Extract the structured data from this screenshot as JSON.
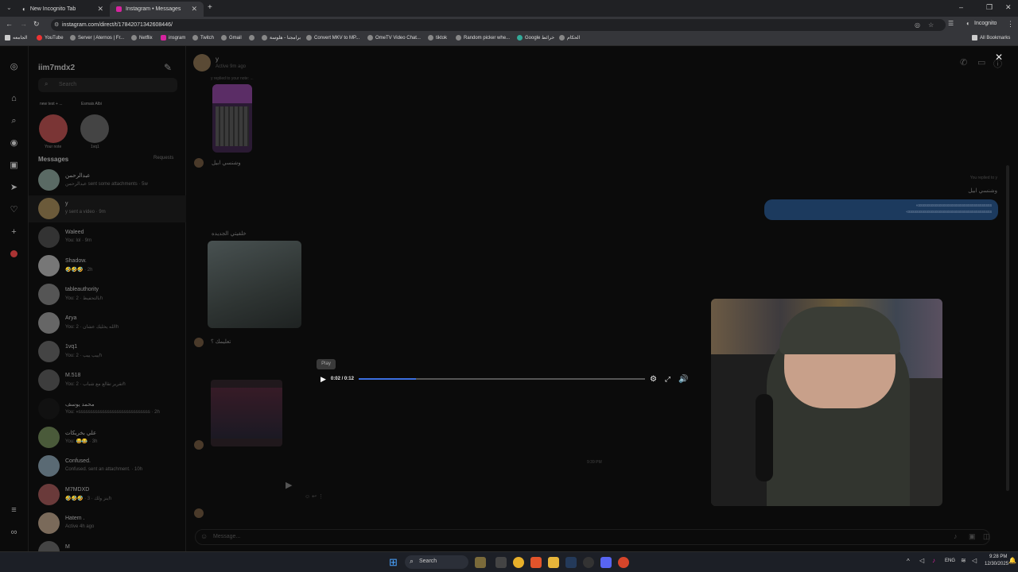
{
  "browser": {
    "tabs": [
      {
        "title": "New Incognito Tab",
        "close": "✕"
      },
      {
        "title": "Instagram • Messages",
        "close": "✕"
      }
    ],
    "new_tab": "+",
    "url": "instagram.com/direct/t/17842071342608446/",
    "incognito": "Incognito",
    "bookmarks": [
      "الجامعه",
      "YouTube",
      "Server | Aternos | Fr...",
      "Netflix",
      "insgram",
      "Twitch",
      "Gmail",
      "",
      "برامجنا - هلوسة",
      "Convert MKV to MP...",
      "OmeTV Video Chat...",
      "tiktok",
      "Random picker whe...",
      "Google خرائط",
      "الحكام"
    ],
    "all_bookmarks": "All Bookmarks"
  },
  "sidebar": {
    "username": "iim7mdx2",
    "search_placeholder": "Search",
    "notes": [
      {
        "note": "new test + ...",
        "label": "Your note"
      },
      {
        "note": "Esmais Albi",
        "label": "1vq1"
      }
    ],
    "messages_header": "Messages",
    "requests": "Requests",
    "conversations": [
      {
        "name": "عبدالرحمن",
        "sub": "عبدالرحمن sent some attachments · 5w",
        "color": "#5a6a64"
      },
      {
        "name": "y",
        "sub": "y sent a video · 9m",
        "color": "#6b5a3a"
      },
      {
        "name": "Waleed",
        "sub": "You: lol · 9m",
        "color": "#333"
      },
      {
        "name": "Shadow.",
        "sub": "🤣🤣🤣 · 2h",
        "color": "#777"
      },
      {
        "name": "tableauthority",
        "sub": "You: بالتحفيظ · 2h",
        "color": "#555"
      },
      {
        "name": "Arya",
        "sub": "You: الله يخليك عشان · 2h",
        "color": "#666"
      },
      {
        "name": "1vq1",
        "sub": "You: ييب ييب · 2h",
        "color": "#444"
      },
      {
        "name": "M.518",
        "sub": "You: تقرير تقالع مع شباب · 2h",
        "color": "#3d3d3d"
      },
      {
        "name": "محمد يوسف",
        "sub": "You: «ssssssssssssssssssssssssssssss · 2h",
        "color": "#111"
      },
      {
        "name": "علي بخريكات",
        "sub": "You: 😂😂 · 3h",
        "color": "#4a5a3a"
      },
      {
        "name": "Confused.",
        "sub": "Confused. sent an attachment. · 10h",
        "color": "#5a6a74"
      },
      {
        "name": "M7MDXD",
        "sub": "🤣🤣🤣 · ينز ولك · 3h",
        "color": "#6a3a3a"
      },
      {
        "name": "Hatem .",
        "sub": "Active 4h ago",
        "color": "#7a6a5a"
      },
      {
        "name": "M",
        "sub": "",
        "color": "#444"
      }
    ]
  },
  "chat": {
    "name": "y",
    "status": "Active 9m ago",
    "reply_caption": "y replied to your note: ...",
    "msg1": "وشنسي ابيل",
    "your_reply_label": "You replied to y",
    "your_reply_quote": "وشنسي ابيل",
    "blue_line1": "«sssssssssssssssssssssssssssssssssssss",
    "blue_line2": "«ssssssssssssssssssssssssssssssssssssssssss",
    "note_label": "خلفيتي الجديده",
    "msg2": "تعليمك ؟",
    "time": "9:39 PM",
    "composer_placeholder": "Message..."
  },
  "video": {
    "tooltip": "Play",
    "time": "0:02 / 0:12",
    "progress": 0.2
  },
  "taskbar": {
    "search": "Search",
    "lang": "ENG",
    "clock": "9:28 PM",
    "date": "12/30/2025"
  }
}
